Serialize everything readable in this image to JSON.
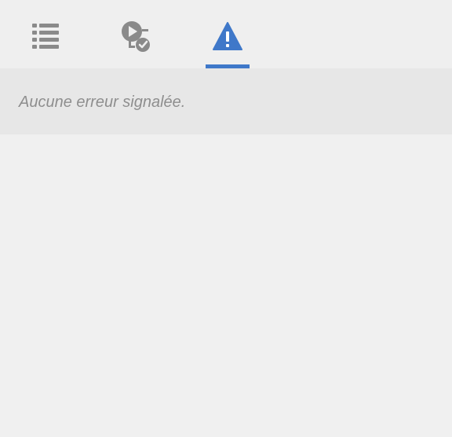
{
  "tabs": [
    {
      "id": "list",
      "icon": "list-icon",
      "active": false
    },
    {
      "id": "preflight",
      "icon": "play-check-icon",
      "active": false
    },
    {
      "id": "errors",
      "icon": "warning-icon",
      "active": true
    }
  ],
  "errors_panel": {
    "message": "Aucune erreur signalée."
  },
  "colors": {
    "active_tab": "#3f78c9",
    "inactive_icon": "#8a8a8a",
    "message_text": "#8e8e8e",
    "message_bg": "#e7e7e7",
    "panel_bg": "#f0f0f0"
  }
}
